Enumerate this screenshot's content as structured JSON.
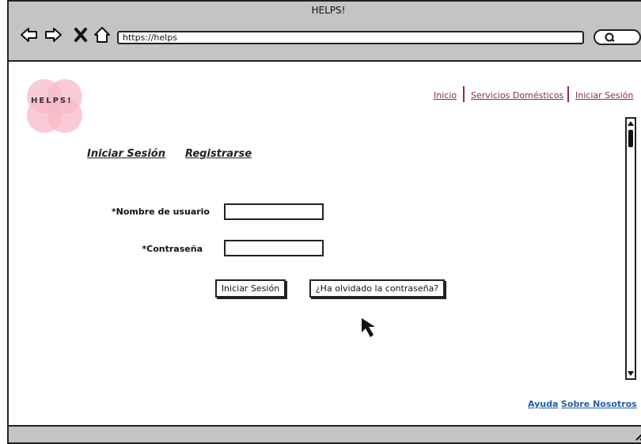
{
  "window": {
    "title": "HELPS!"
  },
  "toolbar": {
    "url": "https://helps",
    "icons": [
      "back-arrow-icon",
      "forward-arrow-icon",
      "close-icon",
      "home-icon",
      "search-icon"
    ]
  },
  "logo": {
    "text": "HELPS!"
  },
  "top_nav": {
    "items": [
      "Inicio",
      "Servicios Domésticos",
      "Iniciar Sesión"
    ]
  },
  "tabs": [
    "Iniciar Sesión",
    "Registrarse"
  ],
  "form": {
    "username_label": "*Nombre de usuario",
    "username_value": "",
    "password_label": "*Contraseña",
    "password_value": ""
  },
  "buttons": {
    "login": "Iniciar Sesión",
    "forgot": "¿Ha olvidado la contraseña?"
  },
  "footer": {
    "links": [
      "Ayuda",
      "Sobre Nosotros"
    ]
  },
  "colors": {
    "nav_link": "#8b2c46",
    "footer_link": "#1f5ea8",
    "logo_pink": "#f7b9c6",
    "chrome": "#c4c4c4"
  }
}
